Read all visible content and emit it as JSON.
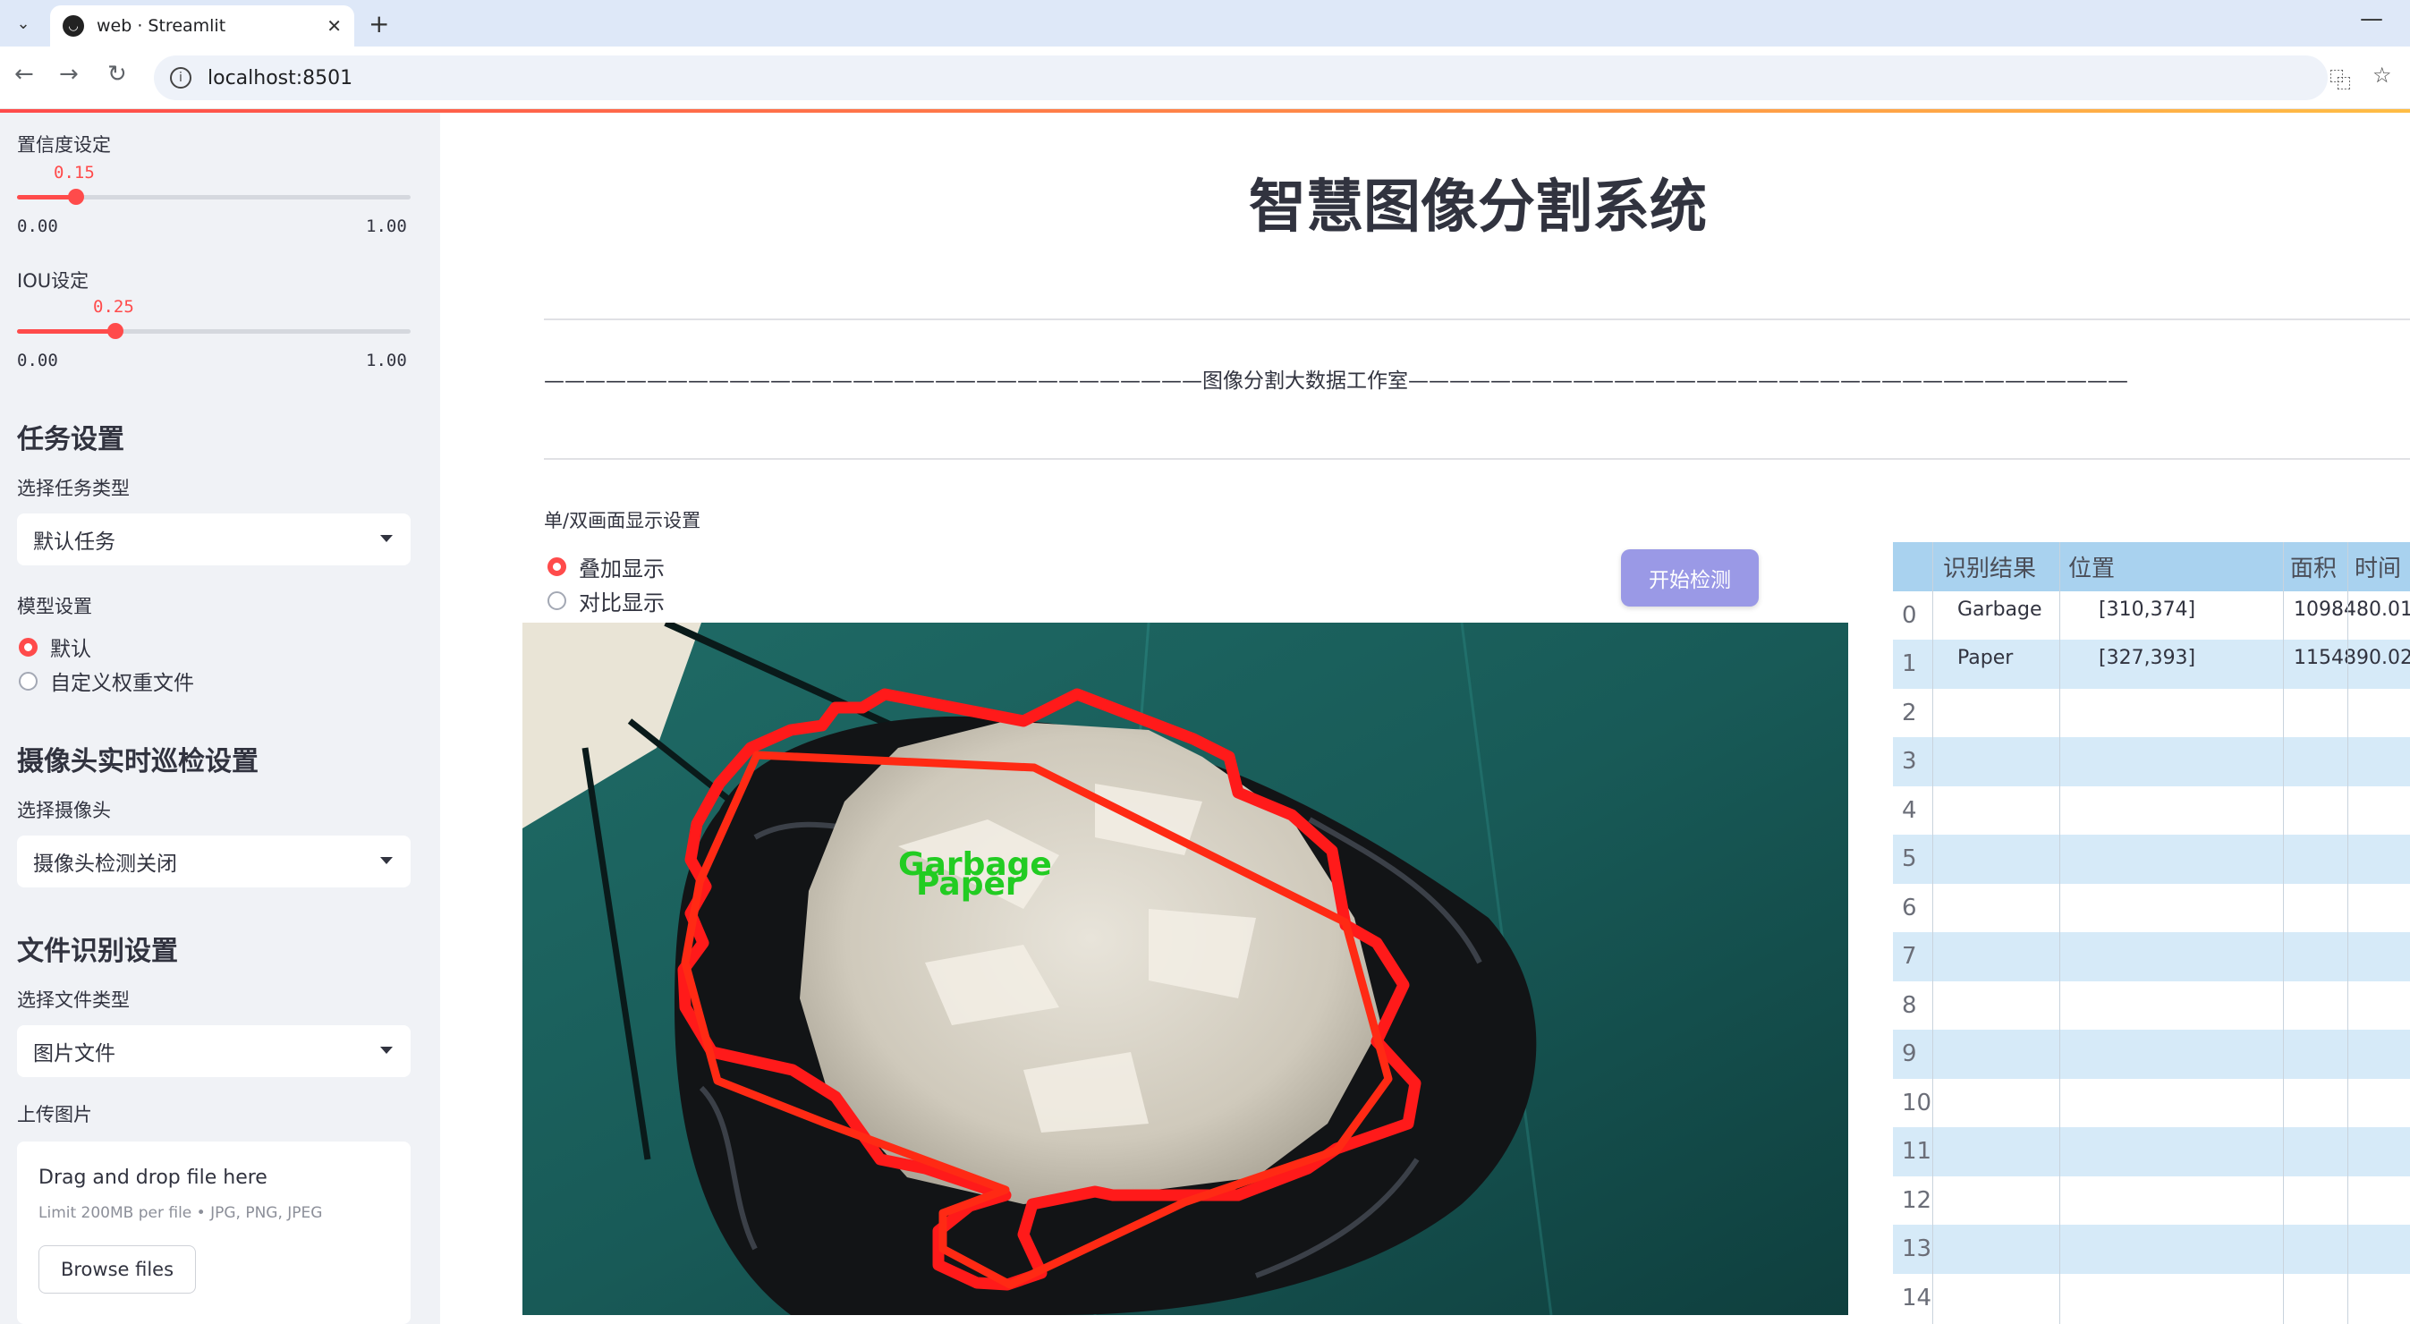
{
  "browser": {
    "tab_title": "web · Streamlit",
    "url": "localhost:8501",
    "new_tab": "+",
    "close_tab": "✕",
    "minimize": "—"
  },
  "sidebar": {
    "confidence_label": "置信度设定",
    "confidence_value": "0.15",
    "confidence_fraction": 0.15,
    "confidence_min": "0.00",
    "confidence_max": "1.00",
    "iou_label": "IOU设定",
    "iou_value": "0.25",
    "iou_fraction": 0.25,
    "iou_min": "0.00",
    "iou_max": "1.00",
    "task_heading": "任务设置",
    "task_type_label": "选择任务类型",
    "task_type_value": "默认任务",
    "model_label": "模型设置",
    "model_options": [
      "默认",
      "自定义权重文件"
    ],
    "model_selected": "默认",
    "camera_heading": "摄像头实时巡检设置",
    "camera_label": "选择摄像头",
    "camera_value": "摄像头检测关闭",
    "file_heading": "文件识别设置",
    "file_type_label": "选择文件类型",
    "file_type_value": "图片文件",
    "upload_label": "上传图片",
    "upload_title": "Drag and drop file here",
    "upload_limit": "Limit 200MB per file • JPG, PNG, JPEG",
    "browse_button": "Browse files"
  },
  "main": {
    "title": "智慧图像分割系统",
    "banner": "————————————————————————————————图像分割大数据工作室———————————————————————————————————",
    "display_label": "单/双画面显示设置",
    "display_options": [
      "叠加显示",
      "对比显示"
    ],
    "display_selected": "叠加显示",
    "start_button": "开始检测",
    "overlay_labels": [
      "Garbage",
      "Paper"
    ]
  },
  "table": {
    "columns": [
      "识别结果",
      "位置",
      "面积",
      "时间"
    ],
    "rows": [
      {
        "index": "0",
        "result": "Garbage",
        "position": "[310,374]",
        "area": "1098480.01",
        "time": ""
      },
      {
        "index": "1",
        "result": "Paper",
        "position": "[327,393]",
        "area": "1154890.02",
        "time": ""
      },
      {
        "index": "2",
        "result": "",
        "position": "",
        "area": "",
        "time": ""
      },
      {
        "index": "3",
        "result": "",
        "position": "",
        "area": "",
        "time": ""
      },
      {
        "index": "4",
        "result": "",
        "position": "",
        "area": "",
        "time": ""
      },
      {
        "index": "5",
        "result": "",
        "position": "",
        "area": "",
        "time": ""
      },
      {
        "index": "6",
        "result": "",
        "position": "",
        "area": "",
        "time": ""
      },
      {
        "index": "7",
        "result": "",
        "position": "",
        "area": "",
        "time": ""
      },
      {
        "index": "8",
        "result": "",
        "position": "",
        "area": "",
        "time": ""
      },
      {
        "index": "9",
        "result": "",
        "position": "",
        "area": "",
        "time": ""
      },
      {
        "index": "10",
        "result": "",
        "position": "",
        "area": "",
        "time": ""
      },
      {
        "index": "11",
        "result": "",
        "position": "",
        "area": "",
        "time": ""
      },
      {
        "index": "12",
        "result": "",
        "position": "",
        "area": "",
        "time": ""
      },
      {
        "index": "13",
        "result": "",
        "position": "",
        "area": "",
        "time": ""
      },
      {
        "index": "14",
        "result": "",
        "position": "",
        "area": "",
        "time": ""
      }
    ]
  },
  "colors": {
    "accent": "#ff4b4b",
    "sidebar_bg": "#f0f2f6",
    "button": "#9a99e6",
    "table_header": "#a9d2ef",
    "table_stripe": "#d6eaf8",
    "mask_outline": "#ff1a1a",
    "mask_label": "#22cc22"
  }
}
